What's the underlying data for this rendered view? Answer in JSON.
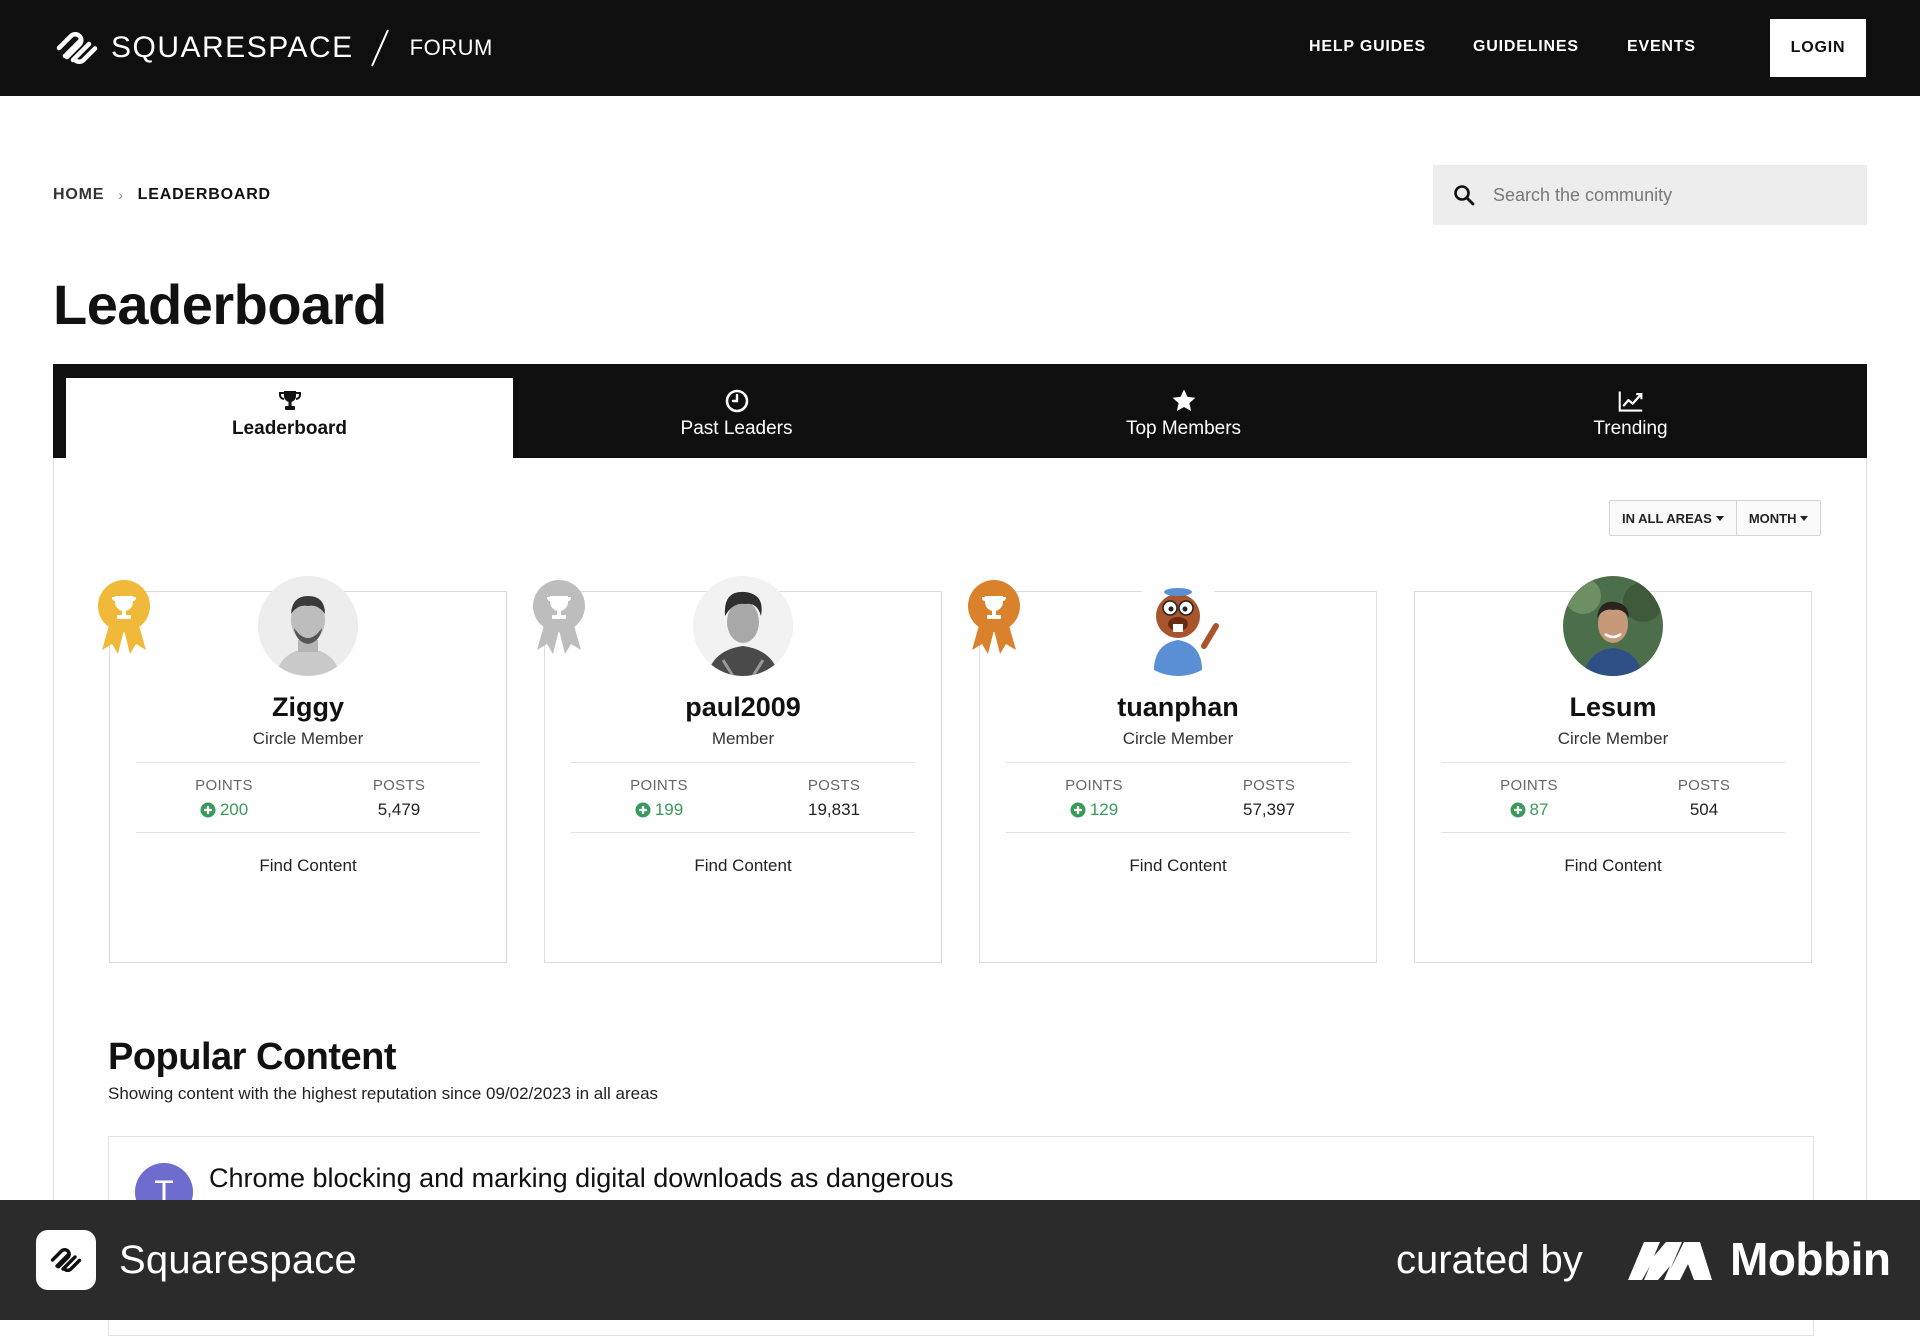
{
  "topbar": {
    "brand": "SQUARESPACE",
    "section": "FORUM",
    "nav": [
      "HELP GUIDES",
      "GUIDELINES",
      "EVENTS"
    ],
    "login": "LOGIN"
  },
  "breadcrumb": {
    "home": "HOME",
    "current": "LEADERBOARD"
  },
  "search": {
    "placeholder": "Search the community"
  },
  "page_title": "Leaderboard",
  "tabs": [
    {
      "label": "Leaderboard",
      "icon": "trophy-icon",
      "active": true
    },
    {
      "label": "Past Leaders",
      "icon": "clock-icon",
      "active": false
    },
    {
      "label": "Top Members",
      "icon": "star-icon",
      "active": false
    },
    {
      "label": "Trending",
      "icon": "trending-chart-icon",
      "active": false
    }
  ],
  "filters": {
    "area": "IN ALL AREAS",
    "period": "MONTH"
  },
  "leaders": [
    {
      "name": "Ziggy",
      "role": "Circle Member",
      "points_label": "POINTS",
      "points": "200",
      "posts_label": "POSTS",
      "posts": "5,479",
      "link": "Find Content",
      "medal": "gold",
      "medal_color": "#f0b93a"
    },
    {
      "name": "paul2009",
      "role": "Member",
      "points_label": "POINTS",
      "points": "199",
      "posts_label": "POSTS",
      "posts": "19,831",
      "link": "Find Content",
      "medal": "silver",
      "medal_color": "#bdbdbd"
    },
    {
      "name": "tuanphan",
      "role": "Circle Member",
      "points_label": "POINTS",
      "points": "129",
      "posts_label": "POSTS",
      "posts": "57,397",
      "link": "Find Content",
      "medal": "bronze",
      "medal_color": "#d9822b"
    },
    {
      "name": "Lesum",
      "role": "Circle Member",
      "points_label": "POINTS",
      "points": "87",
      "posts_label": "POSTS",
      "posts": "504",
      "link": "Find Content",
      "medal": "none"
    }
  ],
  "popular": {
    "title": "Popular Content",
    "subtitle": "Showing content with the highest reputation since 09/02/2023 in all areas",
    "first_post": {
      "avatar_letter": "T",
      "title": "Chrome blocking and marking digital downloads as dangerous"
    }
  },
  "footer": {
    "app": "Squarespace",
    "curated": "curated by",
    "brand": "Mobbin"
  },
  "colors": {
    "topbar": "#0f0f0f",
    "points_green": "#3a9a5b",
    "avatar_purple": "#6f6ccf"
  }
}
